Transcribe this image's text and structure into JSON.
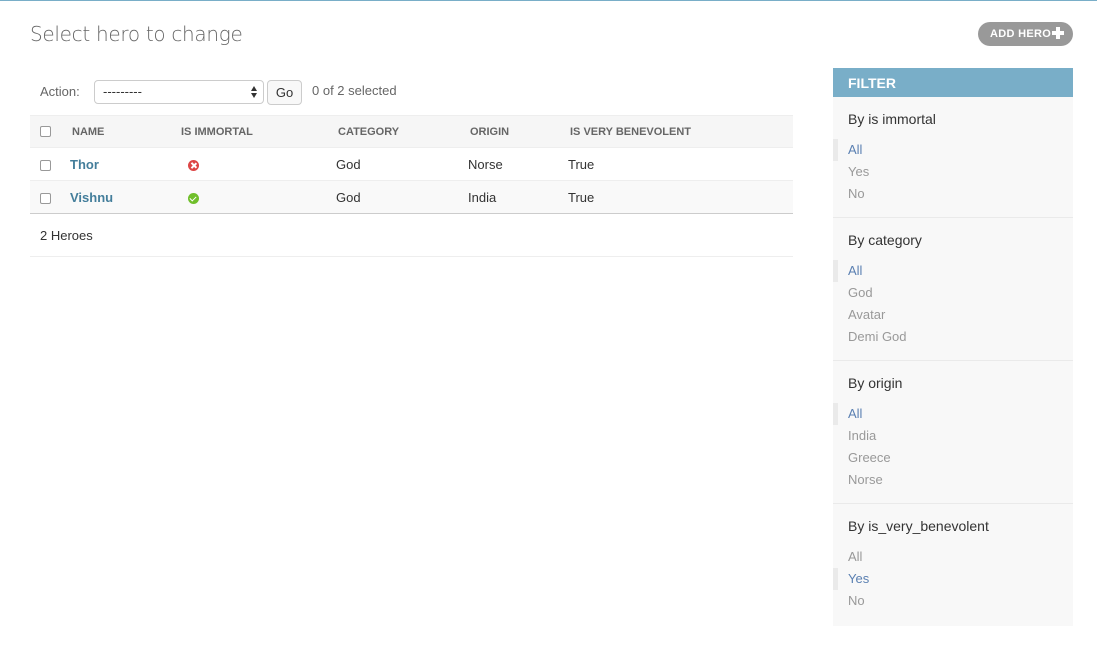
{
  "page": {
    "title": "Select hero to change",
    "add_button": "ADD HERO"
  },
  "actions": {
    "label": "Action:",
    "selected_option": "---------",
    "go_label": "Go",
    "selection_count": "0 of 2 selected"
  },
  "table": {
    "headers": [
      "NAME",
      "IS IMMORTAL",
      "CATEGORY",
      "ORIGIN",
      "IS VERY BENEVOLENT"
    ],
    "rows": [
      {
        "name": "Thor",
        "is_immortal": "no-icon",
        "category": "God",
        "origin": "Norse",
        "is_very_benevolent": "True"
      },
      {
        "name": "Vishnu",
        "is_immortal": "yes-icon",
        "category": "God",
        "origin": "India",
        "is_very_benevolent": "True"
      }
    ]
  },
  "paginator": {
    "text": "2 Heroes"
  },
  "filter": {
    "title": "FILTER",
    "groups": [
      {
        "title": "By is immortal",
        "options": [
          "All",
          "Yes",
          "No"
        ],
        "selected": "All"
      },
      {
        "title": "By category",
        "options": [
          "All",
          "God",
          "Avatar",
          "Demi God"
        ],
        "selected": "All"
      },
      {
        "title": "By origin",
        "options": [
          "All",
          "India",
          "Greece",
          "Norse"
        ],
        "selected": "All"
      },
      {
        "title": "By is_very_benevolent",
        "options": [
          "All",
          "Yes",
          "No"
        ],
        "selected": "Yes"
      }
    ]
  },
  "colors": {
    "header_accent": "#79aec8",
    "link": "#447e9b",
    "filter_selected": "#5b80b2",
    "icon_no": "#dd4646",
    "icon_yes": "#70bf2b",
    "add_button_bg": "#999999"
  }
}
